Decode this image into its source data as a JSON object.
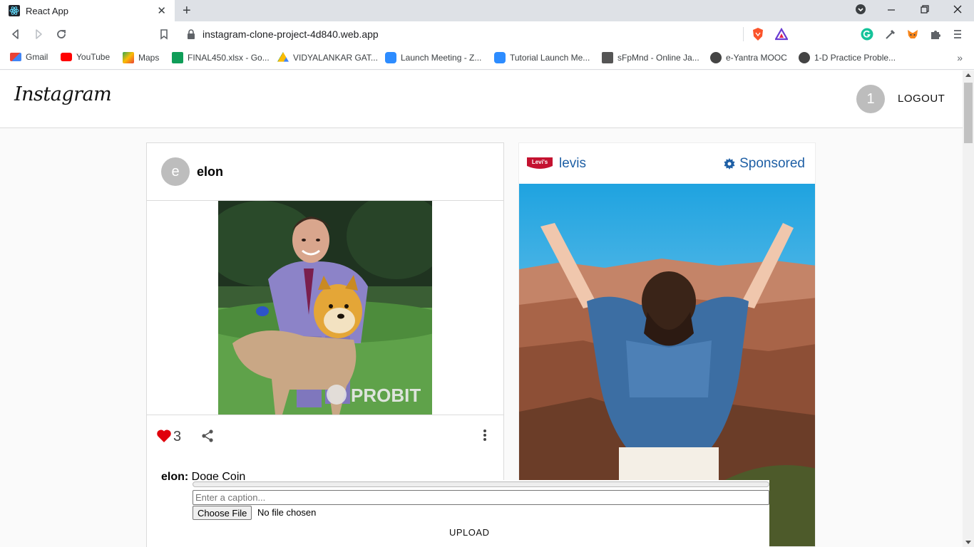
{
  "browser": {
    "tab_title": "React App",
    "tab_close": "✕",
    "new_tab": "+",
    "url": "instagram-clone-project-4d840.web.app",
    "bookmarks": [
      {
        "label": "Gmail",
        "color": "#ea4335"
      },
      {
        "label": "YouTube",
        "color": "#ff0000"
      },
      {
        "label": "Maps",
        "color": "#34a853"
      },
      {
        "label": "FINAL450.xlsx - Go...",
        "color": "#0f9d58"
      },
      {
        "label": "VIDYALANKAR GAT...",
        "color": "#fbbc04"
      },
      {
        "label": "Launch Meeting - Z...",
        "color": "#2d8cff"
      },
      {
        "label": "Tutorial Launch Me...",
        "color": "#2d8cff"
      },
      {
        "label": "sFpMnd - Online Ja...",
        "color": "#555555"
      },
      {
        "label": "e-Yantra MOOC",
        "color": "#444444"
      },
      {
        "label": "1-D Practice Proble...",
        "color": "#444444"
      }
    ],
    "bookmarks_more": "»"
  },
  "header": {
    "logo": "Instagram",
    "avatar_letter": "1",
    "logout_label": "LOGOUT"
  },
  "post": {
    "avatar_letter": "e",
    "username": "elon",
    "image_watermark": "PROBIT",
    "likes": "3",
    "caption_user": "elon:",
    "caption_text": " Doge Coin"
  },
  "ad": {
    "brand": "levis",
    "logo_text": "Levi's",
    "sponsored_label": "Sponsored"
  },
  "upload": {
    "caption_placeholder": "Enter a caption...",
    "choose_file_label": "Choose File",
    "file_status": "No file chosen",
    "upload_label": "UPLOAD",
    "progress": 0
  },
  "colors": {
    "accent_blue": "#1e5fa5",
    "heart_red": "#e0000b"
  }
}
